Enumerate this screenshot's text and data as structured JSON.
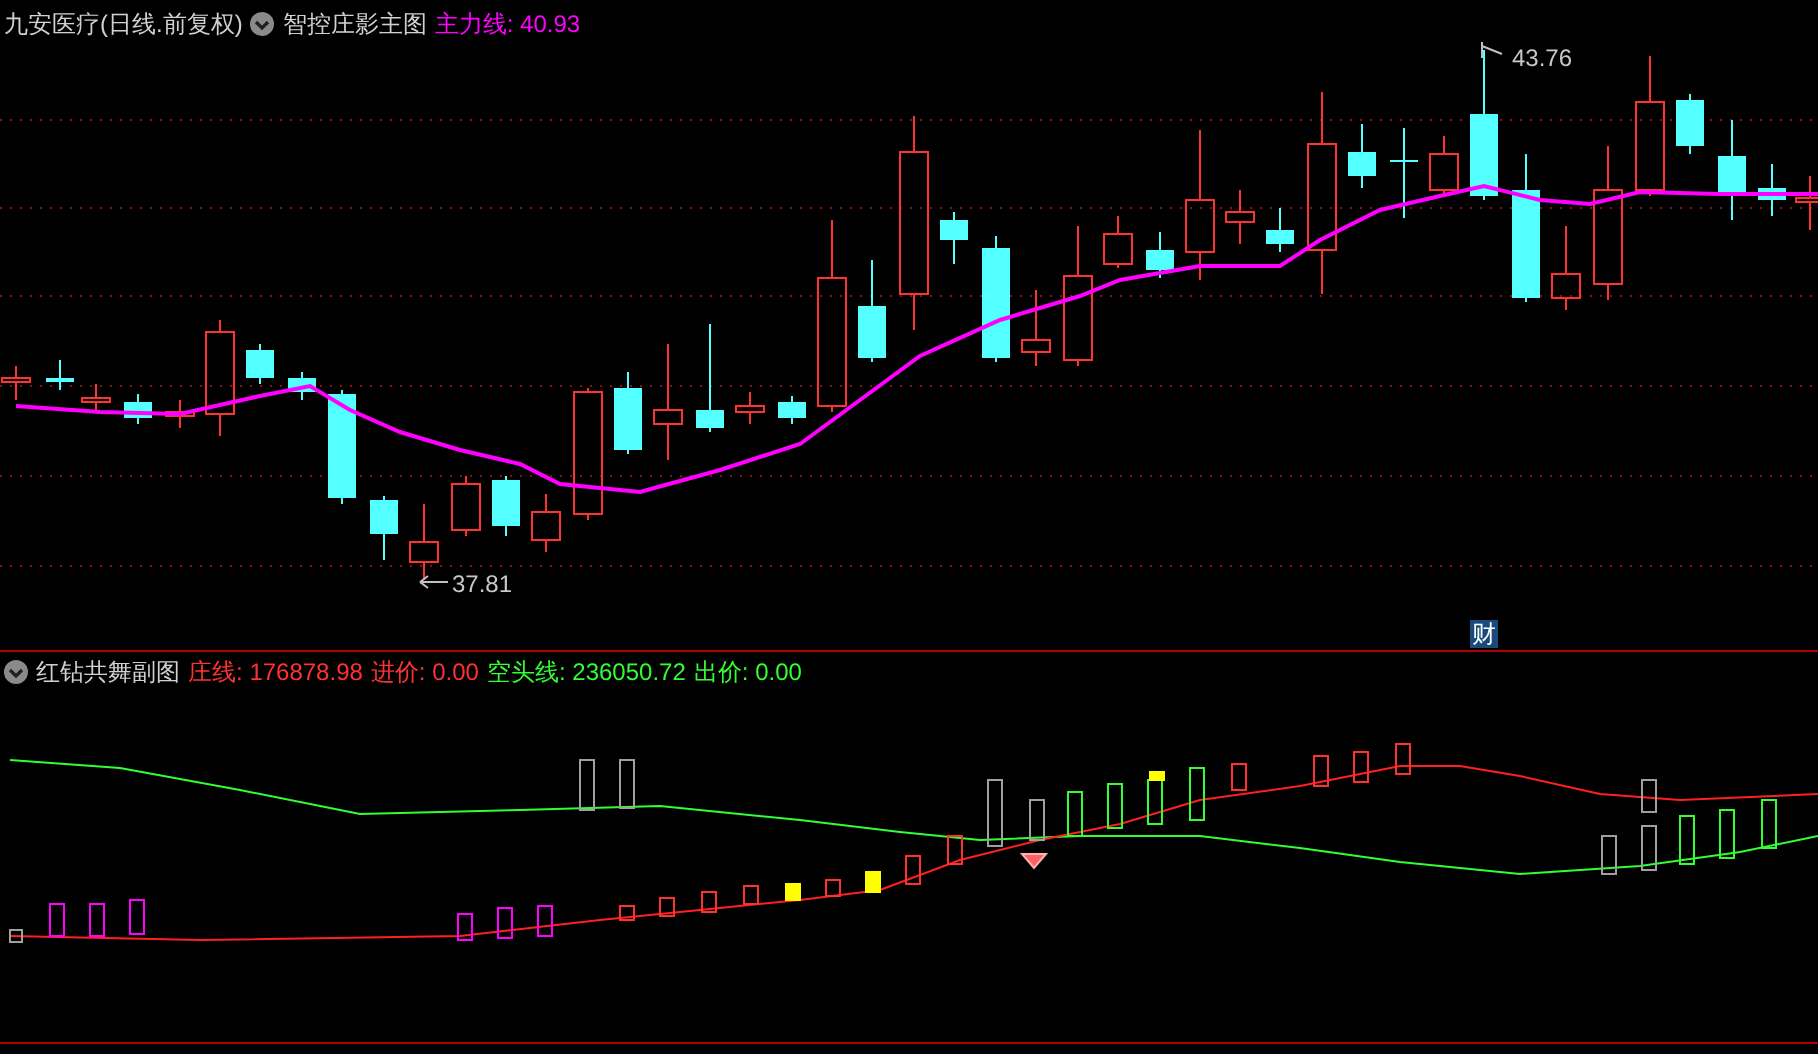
{
  "main_panel": {
    "title": "九安医疗(日线.前复权)",
    "indicator": "智控庄影主图",
    "readouts": [
      {
        "label": "主力线:",
        "value": "40.93",
        "color": "#ff00ff"
      }
    ],
    "high_label": "43.76",
    "low_label": "37.81",
    "marker": "财"
  },
  "sub_panel": {
    "indicator": "红钻共舞副图",
    "readouts": [
      {
        "label": "庄线:",
        "value": "176878.98",
        "color": "#ff3232"
      },
      {
        "label": "进价:",
        "value": "0.00",
        "color": "#ff3232"
      },
      {
        "label": "空头线:",
        "value": "236050.72",
        "color": "#32ff32"
      },
      {
        "label": "出价:",
        "value": "0.00",
        "color": "#32ff32"
      }
    ]
  }
}
